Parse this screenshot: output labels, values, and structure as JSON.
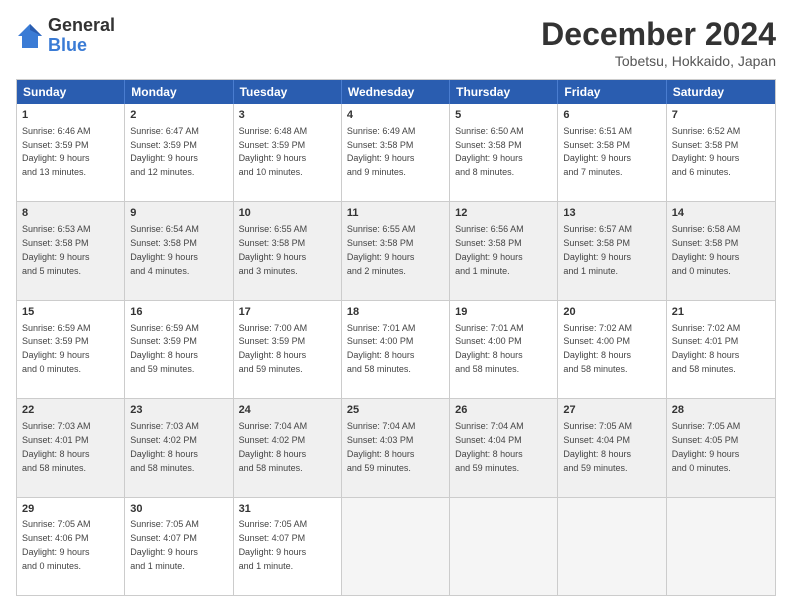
{
  "header": {
    "logo_general": "General",
    "logo_blue": "Blue",
    "month_title": "December 2024",
    "location": "Tobetsu, Hokkaido, Japan"
  },
  "days_of_week": [
    "Sunday",
    "Monday",
    "Tuesday",
    "Wednesday",
    "Thursday",
    "Friday",
    "Saturday"
  ],
  "weeks": [
    [
      {
        "day": "1",
        "text": "Sunrise: 6:46 AM\nSunset: 3:59 PM\nDaylight: 9 hours\nand 13 minutes.",
        "shaded": false
      },
      {
        "day": "2",
        "text": "Sunrise: 6:47 AM\nSunset: 3:59 PM\nDaylight: 9 hours\nand 12 minutes.",
        "shaded": false
      },
      {
        "day": "3",
        "text": "Sunrise: 6:48 AM\nSunset: 3:59 PM\nDaylight: 9 hours\nand 10 minutes.",
        "shaded": false
      },
      {
        "day": "4",
        "text": "Sunrise: 6:49 AM\nSunset: 3:58 PM\nDaylight: 9 hours\nand 9 minutes.",
        "shaded": false
      },
      {
        "day": "5",
        "text": "Sunrise: 6:50 AM\nSunset: 3:58 PM\nDaylight: 9 hours\nand 8 minutes.",
        "shaded": false
      },
      {
        "day": "6",
        "text": "Sunrise: 6:51 AM\nSunset: 3:58 PM\nDaylight: 9 hours\nand 7 minutes.",
        "shaded": false
      },
      {
        "day": "7",
        "text": "Sunrise: 6:52 AM\nSunset: 3:58 PM\nDaylight: 9 hours\nand 6 minutes.",
        "shaded": false
      }
    ],
    [
      {
        "day": "8",
        "text": "Sunrise: 6:53 AM\nSunset: 3:58 PM\nDaylight: 9 hours\nand 5 minutes.",
        "shaded": true
      },
      {
        "day": "9",
        "text": "Sunrise: 6:54 AM\nSunset: 3:58 PM\nDaylight: 9 hours\nand 4 minutes.",
        "shaded": true
      },
      {
        "day": "10",
        "text": "Sunrise: 6:55 AM\nSunset: 3:58 PM\nDaylight: 9 hours\nand 3 minutes.",
        "shaded": true
      },
      {
        "day": "11",
        "text": "Sunrise: 6:55 AM\nSunset: 3:58 PM\nDaylight: 9 hours\nand 2 minutes.",
        "shaded": true
      },
      {
        "day": "12",
        "text": "Sunrise: 6:56 AM\nSunset: 3:58 PM\nDaylight: 9 hours\nand 1 minute.",
        "shaded": true
      },
      {
        "day": "13",
        "text": "Sunrise: 6:57 AM\nSunset: 3:58 PM\nDaylight: 9 hours\nand 1 minute.",
        "shaded": true
      },
      {
        "day": "14",
        "text": "Sunrise: 6:58 AM\nSunset: 3:58 PM\nDaylight: 9 hours\nand 0 minutes.",
        "shaded": true
      }
    ],
    [
      {
        "day": "15",
        "text": "Sunrise: 6:59 AM\nSunset: 3:59 PM\nDaylight: 9 hours\nand 0 minutes.",
        "shaded": false
      },
      {
        "day": "16",
        "text": "Sunrise: 6:59 AM\nSunset: 3:59 PM\nDaylight: 8 hours\nand 59 minutes.",
        "shaded": false
      },
      {
        "day": "17",
        "text": "Sunrise: 7:00 AM\nSunset: 3:59 PM\nDaylight: 8 hours\nand 59 minutes.",
        "shaded": false
      },
      {
        "day": "18",
        "text": "Sunrise: 7:01 AM\nSunset: 4:00 PM\nDaylight: 8 hours\nand 58 minutes.",
        "shaded": false
      },
      {
        "day": "19",
        "text": "Sunrise: 7:01 AM\nSunset: 4:00 PM\nDaylight: 8 hours\nand 58 minutes.",
        "shaded": false
      },
      {
        "day": "20",
        "text": "Sunrise: 7:02 AM\nSunset: 4:00 PM\nDaylight: 8 hours\nand 58 minutes.",
        "shaded": false
      },
      {
        "day": "21",
        "text": "Sunrise: 7:02 AM\nSunset: 4:01 PM\nDaylight: 8 hours\nand 58 minutes.",
        "shaded": false
      }
    ],
    [
      {
        "day": "22",
        "text": "Sunrise: 7:03 AM\nSunset: 4:01 PM\nDaylight: 8 hours\nand 58 minutes.",
        "shaded": true
      },
      {
        "day": "23",
        "text": "Sunrise: 7:03 AM\nSunset: 4:02 PM\nDaylight: 8 hours\nand 58 minutes.",
        "shaded": true
      },
      {
        "day": "24",
        "text": "Sunrise: 7:04 AM\nSunset: 4:02 PM\nDaylight: 8 hours\nand 58 minutes.",
        "shaded": true
      },
      {
        "day": "25",
        "text": "Sunrise: 7:04 AM\nSunset: 4:03 PM\nDaylight: 8 hours\nand 59 minutes.",
        "shaded": true
      },
      {
        "day": "26",
        "text": "Sunrise: 7:04 AM\nSunset: 4:04 PM\nDaylight: 8 hours\nand 59 minutes.",
        "shaded": true
      },
      {
        "day": "27",
        "text": "Sunrise: 7:05 AM\nSunset: 4:04 PM\nDaylight: 8 hours\nand 59 minutes.",
        "shaded": true
      },
      {
        "day": "28",
        "text": "Sunrise: 7:05 AM\nSunset: 4:05 PM\nDaylight: 9 hours\nand 0 minutes.",
        "shaded": true
      }
    ],
    [
      {
        "day": "29",
        "text": "Sunrise: 7:05 AM\nSunset: 4:06 PM\nDaylight: 9 hours\nand 0 minutes.",
        "shaded": false
      },
      {
        "day": "30",
        "text": "Sunrise: 7:05 AM\nSunset: 4:07 PM\nDaylight: 9 hours\nand 1 minute.",
        "shaded": false
      },
      {
        "day": "31",
        "text": "Sunrise: 7:05 AM\nSunset: 4:07 PM\nDaylight: 9 hours\nand 1 minute.",
        "shaded": false
      },
      {
        "day": "",
        "text": "",
        "shaded": false,
        "empty": true
      },
      {
        "day": "",
        "text": "",
        "shaded": false,
        "empty": true
      },
      {
        "day": "",
        "text": "",
        "shaded": false,
        "empty": true
      },
      {
        "day": "",
        "text": "",
        "shaded": false,
        "empty": true
      }
    ]
  ]
}
